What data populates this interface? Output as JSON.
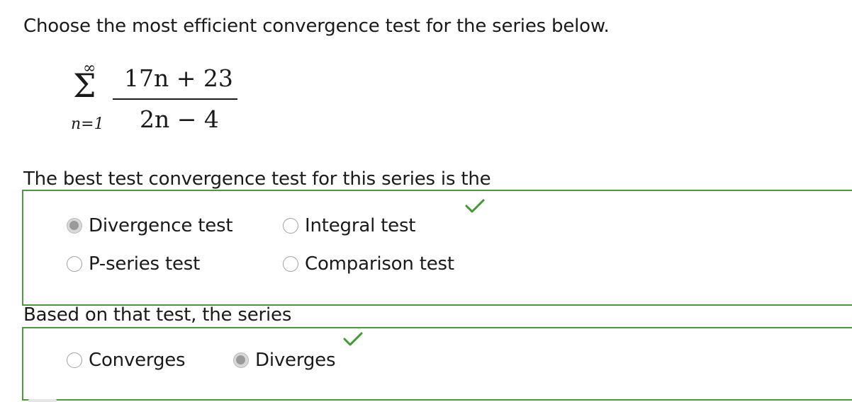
{
  "question": "Choose the most efficient convergence test for the series below.",
  "series": {
    "upper_limit": "∞",
    "lower_limit": "n=1",
    "numerator": "17n + 23",
    "denominator": "2n − 4"
  },
  "test_question": {
    "prompt": "The best test convergence test for this series is the",
    "options": [
      {
        "label": "Divergence test",
        "selected": true
      },
      {
        "label": "Integral test",
        "selected": false
      },
      {
        "label": "P-series test",
        "selected": false
      },
      {
        "label": "Comparison test",
        "selected": false
      }
    ],
    "correct": true
  },
  "result_question": {
    "prompt": "Based on that test, the series",
    "options": [
      {
        "label": "Converges",
        "selected": false
      },
      {
        "label": "Diverges",
        "selected": true
      }
    ],
    "correct": true
  },
  "colors": {
    "correct_border": "#4c9a3b",
    "check": "#3f9a2f",
    "radio_selected": "#9a9a9a"
  },
  "icons": {
    "correct": "checkmark-icon",
    "series": "sigma-icon"
  }
}
